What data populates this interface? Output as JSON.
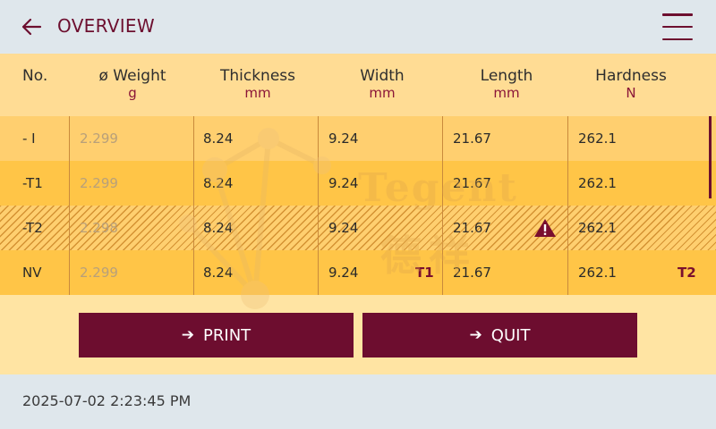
{
  "header": {
    "title": "OVERVIEW",
    "back_icon": "arrow-left-icon",
    "menu_icon": "hamburger-menu-icon"
  },
  "table": {
    "columns": [
      {
        "label": "No.",
        "unit": ""
      },
      {
        "label": "ø Weight",
        "unit": "g"
      },
      {
        "label": "Thickness",
        "unit": "mm"
      },
      {
        "label": "Width",
        "unit": "mm"
      },
      {
        "label": "Length",
        "unit": "mm"
      },
      {
        "label": "Hardness",
        "unit": "N"
      }
    ],
    "rows": [
      {
        "no": "- I",
        "weight": "2.299",
        "thickness": "8.24",
        "width": "9.24",
        "length": "21.67",
        "hardness": "262.1"
      },
      {
        "no": "-T1",
        "weight": "2.299",
        "thickness": "8.24",
        "width": "9.24",
        "length": "21.67",
        "hardness": "262.1"
      },
      {
        "no": "-T2",
        "weight": "2.298",
        "thickness": "8.24",
        "width": "9.24",
        "length": "21.67",
        "hardness": "262.1",
        "warning_icon": "warning-triangle-icon"
      },
      {
        "no": "NV",
        "weight": "2.299",
        "thickness": "8.24",
        "width": "9.24",
        "width_tag": "T1",
        "length": "21.67",
        "hardness": "262.1",
        "hardness_tag": "T2"
      }
    ]
  },
  "watermark": {
    "text": "Tegent",
    "text_cn": "德祥"
  },
  "actions": {
    "print_label": "PRINT",
    "quit_label": "QUIT",
    "arrow_icon": "arrow-right-icon"
  },
  "footer": {
    "timestamp": "2025-07-02  2:23:45 PM"
  },
  "colors": {
    "brand": "#6d0d2f",
    "header_bg": "#dfe7ec",
    "row_light": "#ffcf6f",
    "row_dark": "#ffc547"
  }
}
